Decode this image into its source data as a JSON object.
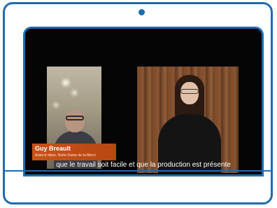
{
  "lower_third": {
    "name": "Guy Breault",
    "title": "Avancé diace, Notre-Dame-de-la-Merci"
  },
  "subtitle": "que le travail soit facile et que la production est présente",
  "colors": {
    "frame": "#1f6bb0",
    "name_tag": "#c7521a"
  }
}
